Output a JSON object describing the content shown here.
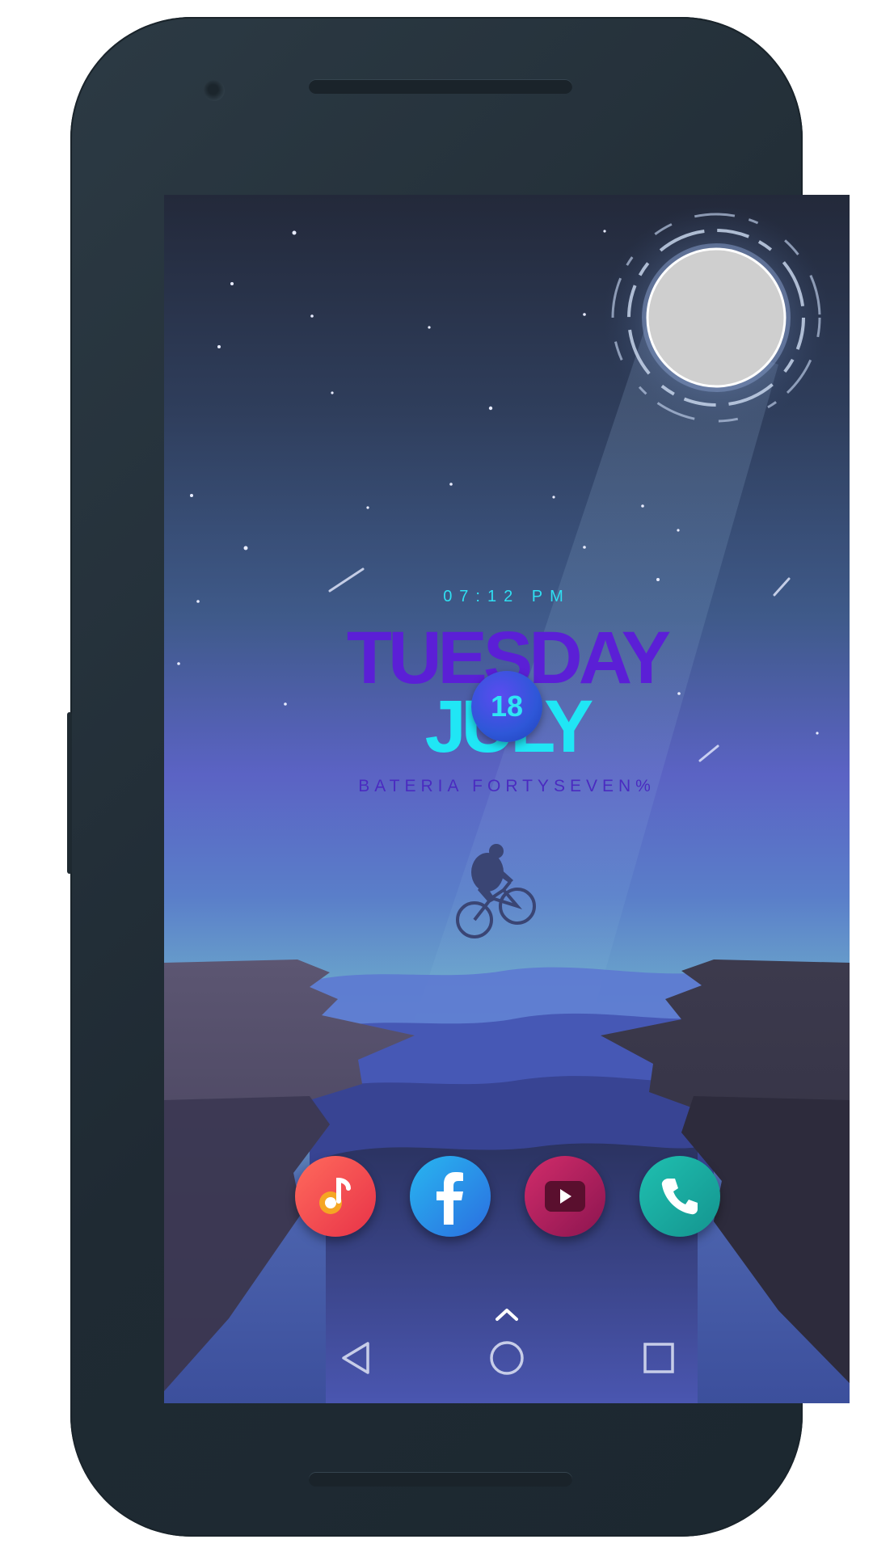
{
  "lockscreen": {
    "time": "07:12 PM",
    "day": "TUESDAY",
    "date": "18",
    "month": "JULY",
    "battery": "BATERIA FORTYSEVEN%"
  },
  "dock": {
    "apps": [
      {
        "name": "music",
        "icon": "music-note-icon",
        "color": "#f2494b"
      },
      {
        "name": "facebook",
        "icon": "facebook-icon",
        "color": "#2b8fe6"
      },
      {
        "name": "youtube",
        "icon": "youtube-play-icon",
        "color": "#b21e5c"
      },
      {
        "name": "phone",
        "icon": "phone-icon",
        "color": "#17a6a0"
      }
    ]
  },
  "navbar": {
    "icons": [
      "app-drawer-chevron-icon",
      "back-icon",
      "home-icon",
      "recents-icon"
    ]
  },
  "colors": {
    "clock_text": "#2fdff2",
    "day_text": "#5b1fd6",
    "month_text": "#20e6f5",
    "battery_text": "#4a2bc0",
    "moon": "#cfcfcf"
  }
}
